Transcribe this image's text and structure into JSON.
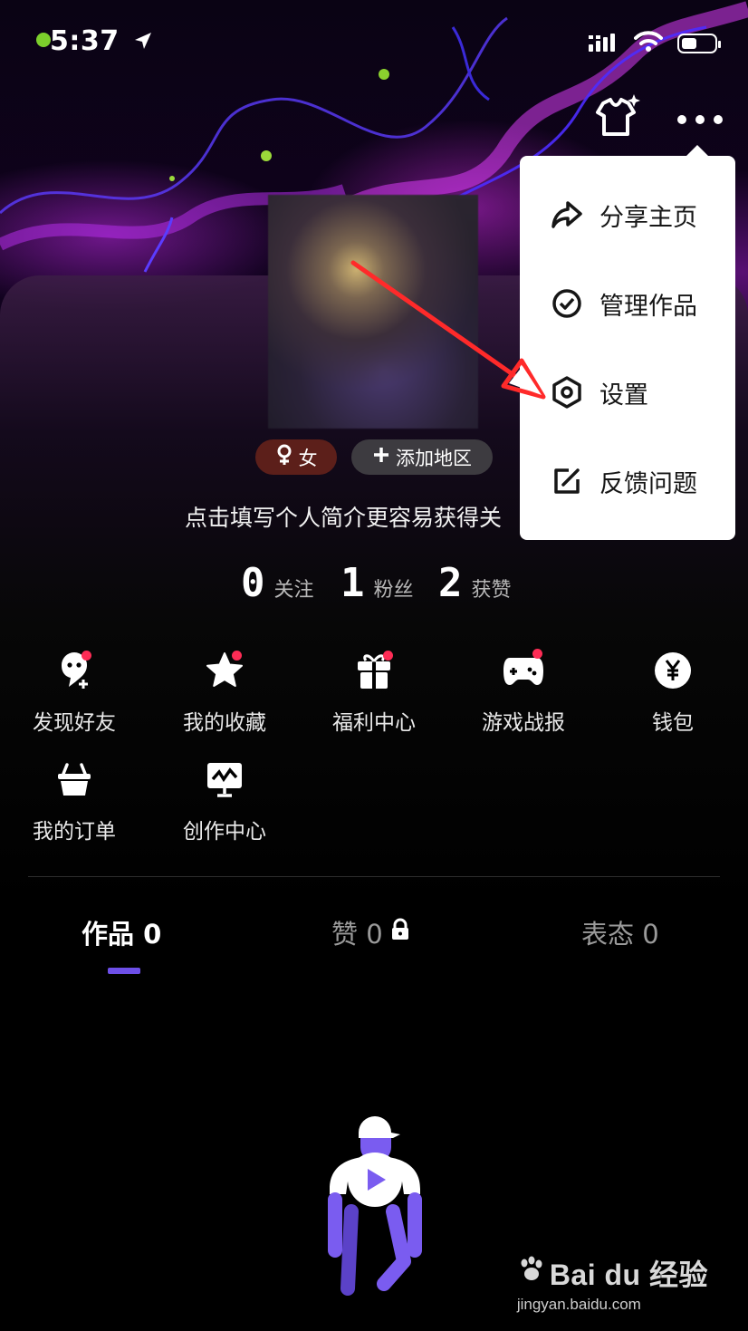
{
  "status_bar": {
    "time": "5:37"
  },
  "profile": {
    "gender_tag": "女",
    "region_tag": "添加地区",
    "bio_placeholder": "点击填写个人简介更容易获得关"
  },
  "stats": [
    {
      "value": "0",
      "label": "关注"
    },
    {
      "value": "1",
      "label": "粉丝"
    },
    {
      "value": "2",
      "label": "获赞"
    }
  ],
  "shortcuts": [
    {
      "label": "发现好友",
      "icon": "find-friends-icon",
      "badge": true
    },
    {
      "label": "我的收藏",
      "icon": "star-icon",
      "badge": true
    },
    {
      "label": "福利中心",
      "icon": "gift-icon",
      "badge": true
    },
    {
      "label": "游戏战报",
      "icon": "gamepad-icon",
      "badge": true
    },
    {
      "label": "钱包",
      "icon": "yuan-icon",
      "badge": false
    },
    {
      "label": "我的订单",
      "icon": "basket-icon",
      "badge": false
    },
    {
      "label": "创作中心",
      "icon": "creator-monitor-icon",
      "badge": false
    }
  ],
  "tabs": [
    {
      "label": "作品 0",
      "active": true
    },
    {
      "label": "赞 0",
      "active": false,
      "locked": true
    },
    {
      "label": "表态 0",
      "active": false
    }
  ],
  "menu": {
    "items": [
      {
        "label": "分享主页",
        "icon": "share-icon"
      },
      {
        "label": "管理作品",
        "icon": "check-circle-icon"
      },
      {
        "label": "设置",
        "icon": "settings-hex-icon"
      },
      {
        "label": "反馈问题",
        "icon": "feedback-edit-icon"
      }
    ]
  },
  "watermark": {
    "brand": "Bai du 经验",
    "url": "jingyan.baidu.com"
  },
  "colors": {
    "accent": "#6d4fe8",
    "badge": "#fe2c55",
    "gender_tag_bg": "#5c1f1a",
    "annotation_arrow": "#ff2a2a"
  }
}
